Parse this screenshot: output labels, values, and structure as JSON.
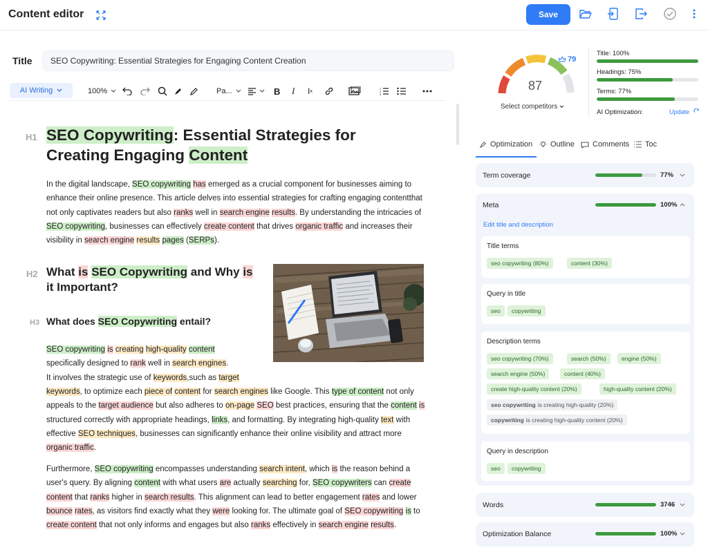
{
  "header": {
    "title": "Content editor",
    "save_label": "Save",
    "icons": [
      "expand-icon",
      "folder-open-icon",
      "import-icon",
      "export-icon",
      "check-circle-icon",
      "more-vertical-icon"
    ]
  },
  "editor": {
    "title_label": "Title",
    "title_value": "SEO Copywriting: Essential Strategies for Engaging Content Creation",
    "toolbar": {
      "ai_label": "AI Writing",
      "zoom": "100%",
      "paragraph_style": "Pa..."
    },
    "levels": {
      "h1": "H1",
      "h2": "H2",
      "h3": "H3"
    },
    "h1": {
      "a": "SEO Copywriting",
      "b": ": Essential Strategies for Creating Engaging ",
      "c": "Content"
    },
    "h2": {
      "a": "What ",
      "b": "is",
      "c": " ",
      "d": "SEO Copywriting",
      "e": " and Why ",
      "f": "is",
      "g": " it Important?"
    },
    "h3": {
      "a": "What does ",
      "b": "SEO Copywriting",
      "c": " entail?"
    },
    "p1": [
      "In the digital landscape, ",
      "SEO copywriting",
      " ",
      "has",
      " emerged as a crucial component for businesses aiming to enhance their online presence. This article delves into essential strategies for crafting engaging contentthat not only captivates readers but also ",
      "ranks",
      " well in ",
      "search engine",
      " ",
      "results",
      ". By understanding the intricacies of ",
      "SEO copywriting",
      ", businesses can effectively ",
      "create content",
      " that drives ",
      "organic traffic",
      " and increases their visibility in ",
      "search engine",
      " ",
      "results",
      " ",
      "pages",
      " (",
      "SERPs",
      ")."
    ],
    "p2": [
      "SEO copywriting",
      " ",
      "is",
      " ",
      "creating",
      " ",
      "high-quality",
      " ",
      "content"
    ],
    "p2b": [
      "specifically designed to ",
      "rank",
      " well in ",
      "search engines",
      "."
    ],
    "p2c": [
      "It involves the strategic use of ",
      "keywords",
      ",such as ",
      "target"
    ],
    "p2d": [
      "keywords",
      ", to optimize each ",
      "piece of",
      " ",
      "content",
      " for ",
      "search engines",
      " like Google. This ",
      "type of content",
      " not only appeals to the ",
      "target audience",
      " but also adheres to ",
      "on-page",
      " ",
      "SEO",
      " best practices, ensuring that the ",
      "content",
      " ",
      "is",
      " structured correctly with appropriate headings, ",
      "links",
      ", and formatting. By integrating high-quality ",
      "text",
      " with effective ",
      "SEO techniques",
      ", businesses can significantly enhance their online visibility and attract more ",
      "organic traffic",
      "."
    ],
    "p3": [
      "Furthermore, ",
      "SEO copywriting",
      " encompasses understanding ",
      "search intent",
      ", which ",
      "is",
      " the reason behind a user's query. By aligning ",
      "content",
      " with what users ",
      "are",
      " actually ",
      "searching",
      " for, ",
      "SEO copywriters",
      " can ",
      "create content",
      " that ",
      "ranks",
      " higher in ",
      "search results",
      ". This alignment can lead to better engagement ",
      "rates",
      " and lower ",
      "bounce",
      " ",
      "rates",
      ", as visitors find exactly what they ",
      "were",
      " looking for. The ultimate goal of ",
      "SEO copywriting",
      " ",
      "is",
      " to ",
      "create content",
      " that not only informs and engages but also ",
      "ranks",
      " effectively in ",
      "search engine",
      " ",
      "results",
      "."
    ]
  },
  "score": {
    "value": "87",
    "competitor_score": "79",
    "competitors_label": "Select competitors"
  },
  "metrics": [
    {
      "label": "Title: 100%",
      "value": 1.0
    },
    {
      "label": "Headings: 75%",
      "value": 0.75
    },
    {
      "label": "Terms: 77%",
      "value": 0.77
    }
  ],
  "ai_optimization": {
    "label": "AI Optimization:",
    "update": "Update"
  },
  "tabs": [
    "Optimization",
    "Outline",
    "Comments",
    "Toc"
  ],
  "term_coverage": {
    "label": "Term coverage",
    "pct": "77%",
    "value": 0.77
  },
  "meta": {
    "label": "Meta",
    "pct": "100%",
    "value": 1.0,
    "edit_link": "Edit title and description",
    "title_terms": {
      "title": "Title terms",
      "chips": [
        "seo copywriting (80%)",
        "content (30%)"
      ]
    },
    "query_title": {
      "title": "Query in title",
      "chips": [
        "seo",
        "copywriting"
      ]
    },
    "desc_terms": {
      "title": "Description terms",
      "chips": [
        "seo copywriting (70%)",
        "search (50%)",
        "engine (50%)",
        "search engine (50%)",
        "content (40%)",
        "create high-quality content (20%)",
        "high-quality content (20%)"
      ],
      "grey": [
        {
          "bold": "seo copywriting",
          "rest": "is creating high-quality (20%)"
        },
        {
          "bold": "copywriting",
          "rest": "is creating high-quality content (20%)"
        }
      ]
    },
    "query_desc": {
      "title": "Query in description",
      "chips": [
        "seo",
        "copywriting"
      ]
    }
  },
  "words": {
    "label": "Words",
    "value": "3746",
    "fill": 1.0
  },
  "balance": {
    "label": "Optimization Balance",
    "pct": "100%",
    "value": 1.0
  }
}
